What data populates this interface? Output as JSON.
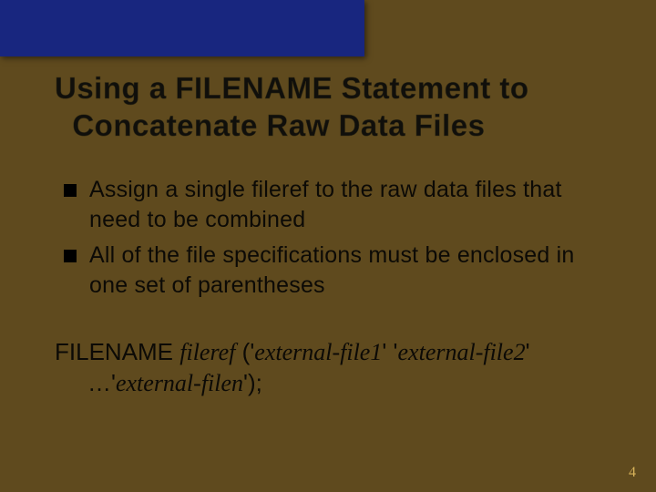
{
  "title_line1": "Using a FILENAME Statement to",
  "title_line2": "Concatenate Raw Data Files",
  "bullets": [
    "Assign a single fileref to the raw data files that need to be combined",
    "All of the file specifications must be enclosed in one set of parentheses"
  ],
  "syntax": {
    "keyword": "FILENAME",
    "fileref": "fileref",
    "open": "(",
    "q": "'",
    "file1": "external-file1",
    "file2": "external-file2",
    "ellipsis": "…",
    "filen": "external-filen",
    "close": ");"
  },
  "page_number": "4"
}
